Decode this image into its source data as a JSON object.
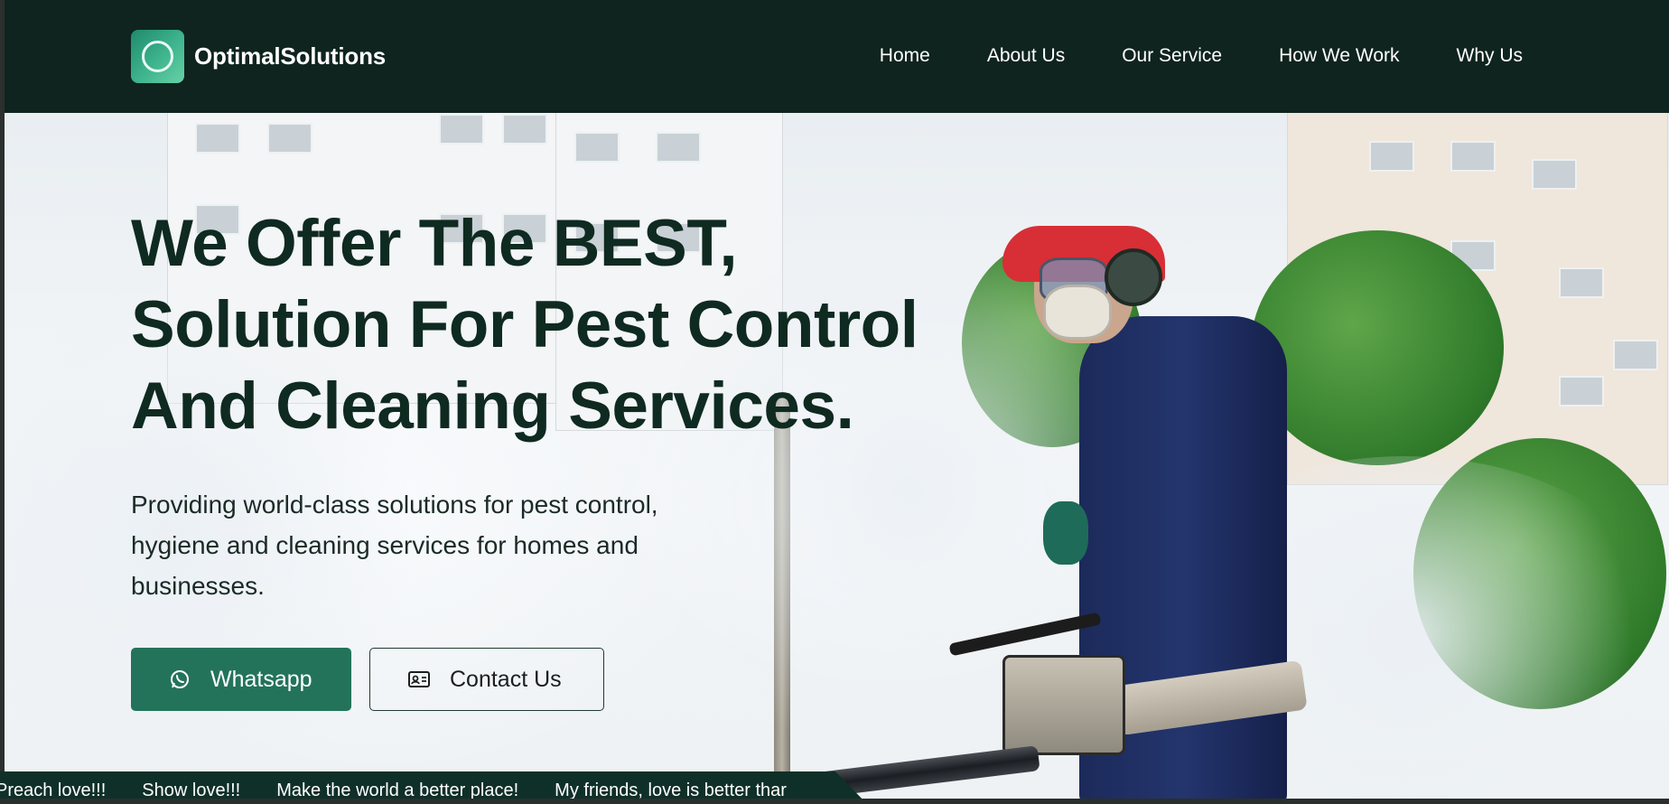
{
  "brand": {
    "name": "OptimalSolutions"
  },
  "nav": {
    "links": [
      "Home",
      "About Us",
      "Our Service",
      "How We Work",
      "Why Us"
    ]
  },
  "hero": {
    "headline": [
      "We Offer The BEST,",
      "Solution For Pest Control",
      "And Cleaning Services."
    ],
    "subtitle": "Providing world-class solutions for pest control, hygiene and cleaning services for homes and businesses.",
    "buttons": {
      "whatsapp": {
        "label": "Whatsapp",
        "icon": "whatsapp-icon"
      },
      "contact": {
        "label": "Contact Us",
        "icon": "contact-card-icon"
      }
    }
  },
  "marquee": {
    "items": [
      "Preach love!!!",
      "Show love!!!",
      "Make the world a better place!",
      "My friends, love is better thar"
    ]
  },
  "colors": {
    "nav_bg": "#0f241e",
    "primary": "#23735a",
    "headline": "#0f2a20",
    "marquee_bg": "#0f3028"
  }
}
